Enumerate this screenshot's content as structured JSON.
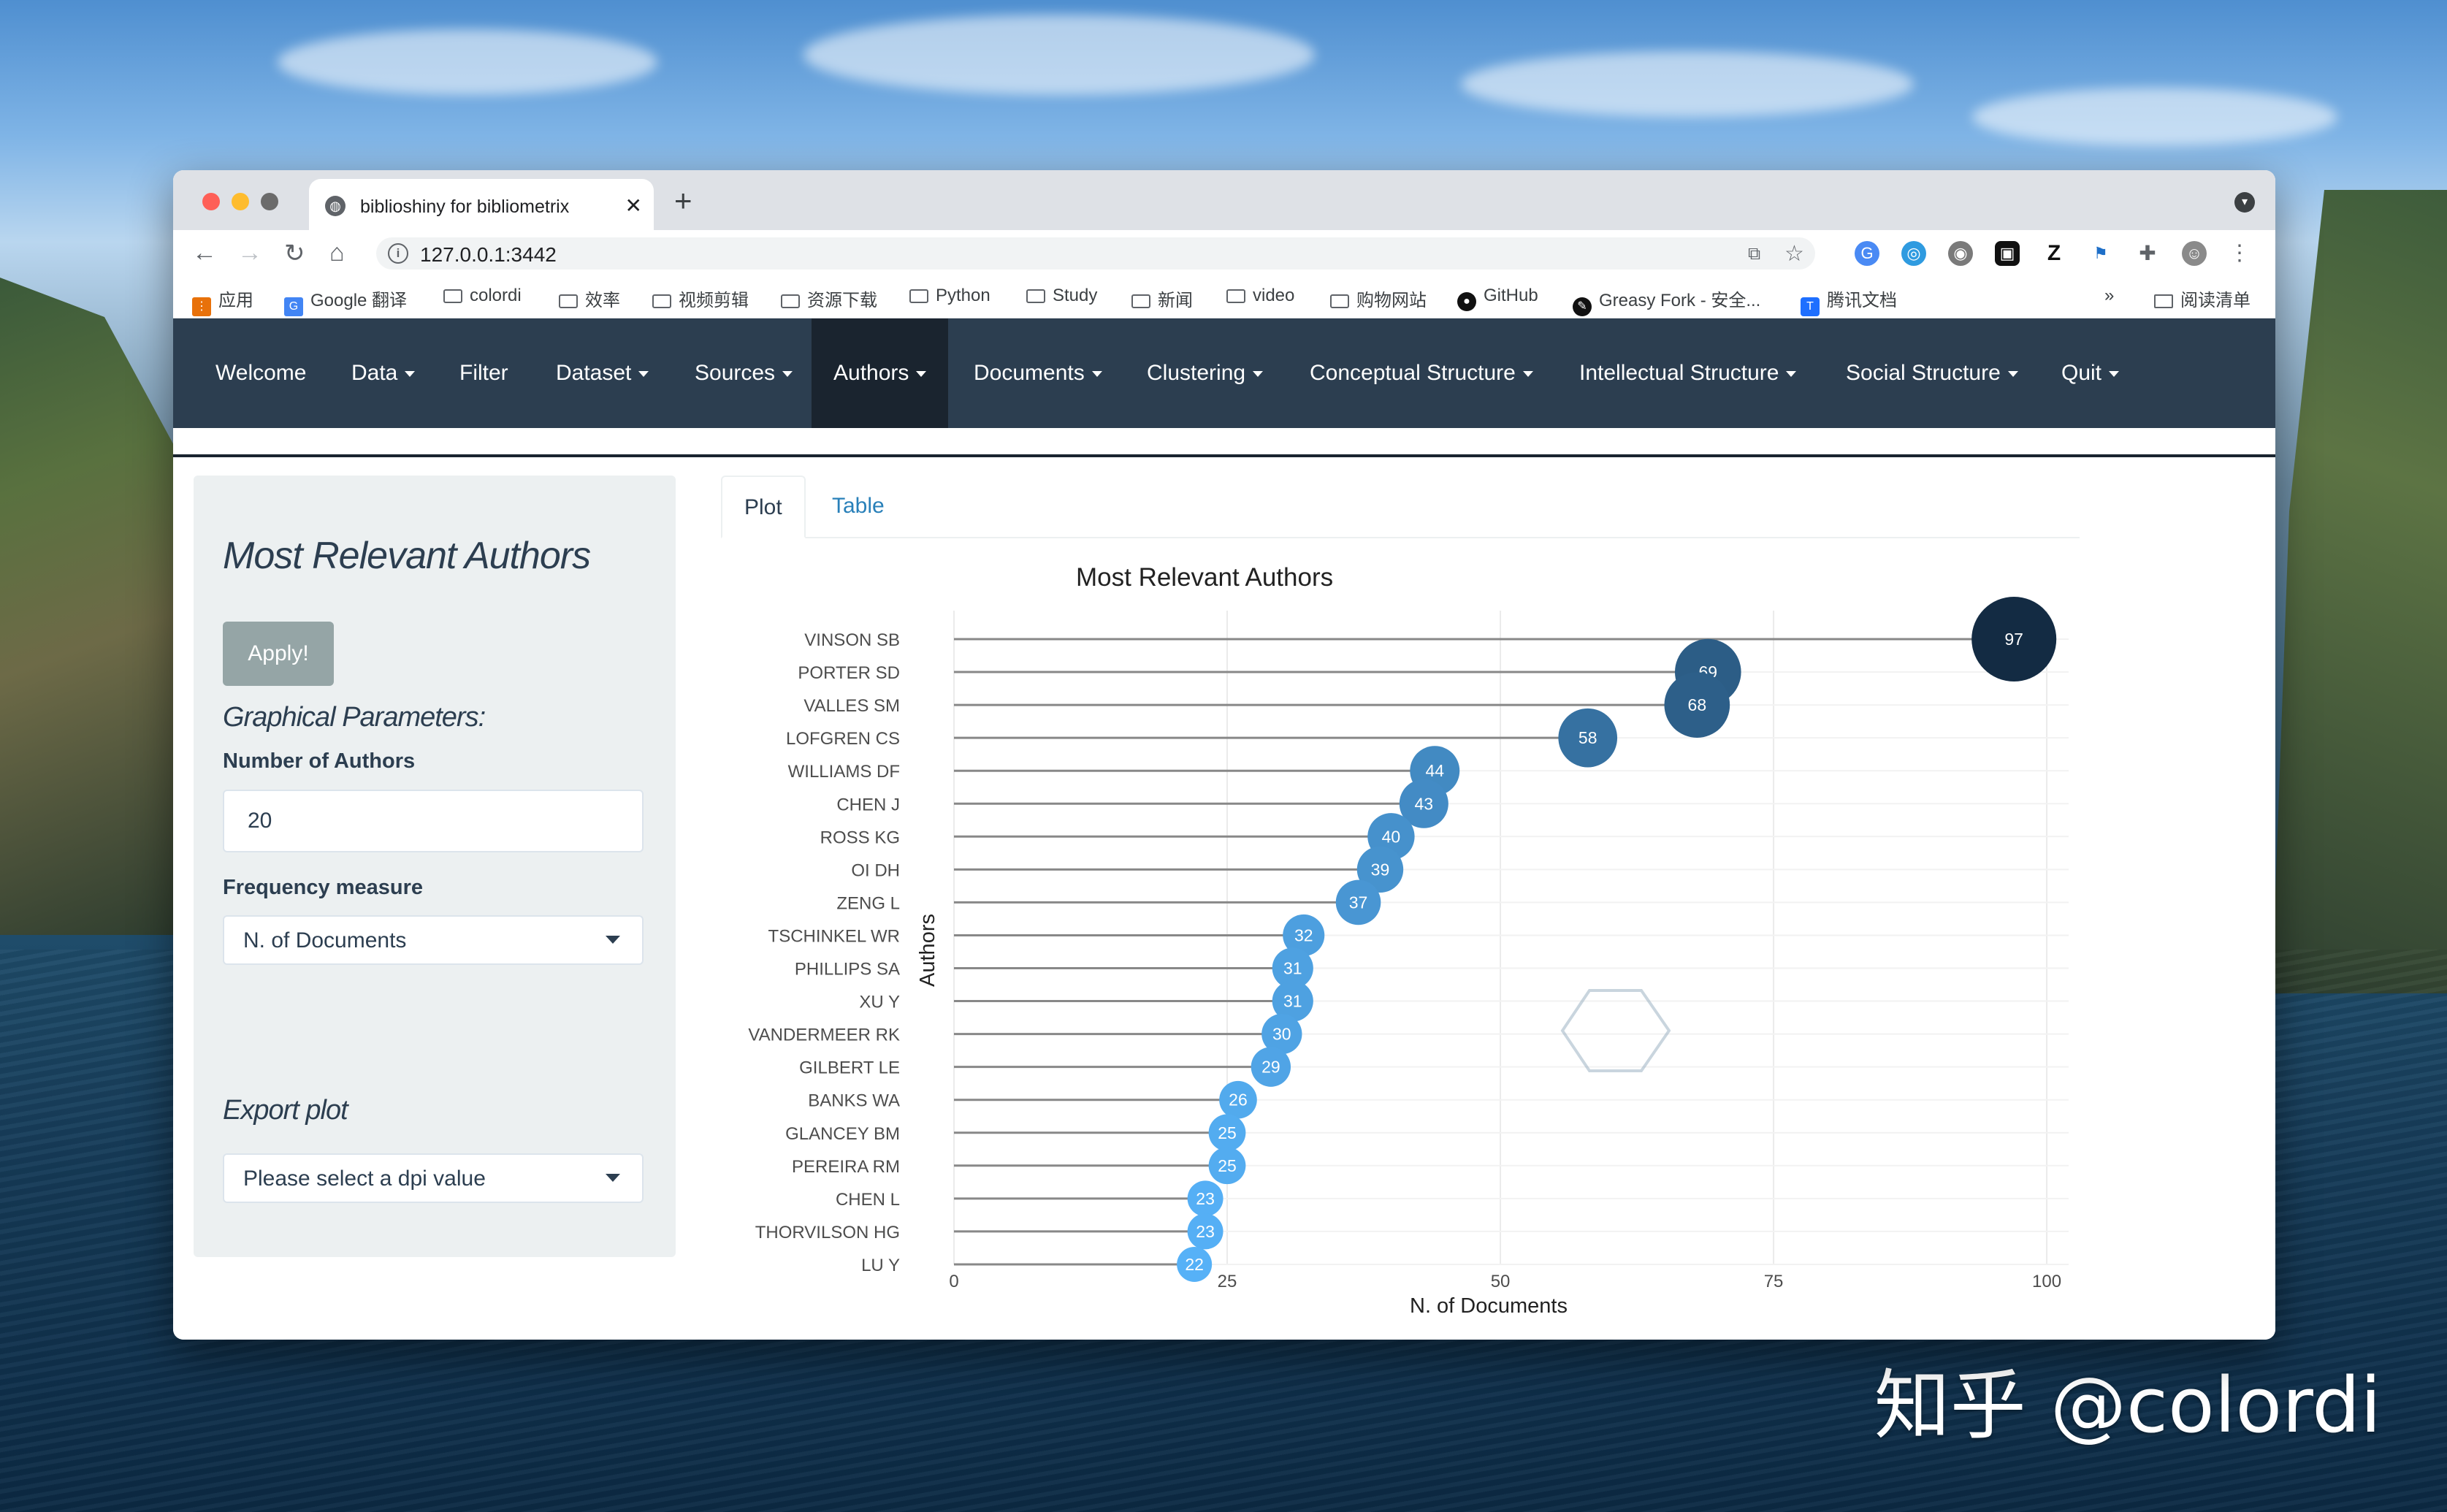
{
  "browser": {
    "tab_title": "biblioshiny for bibliometrix",
    "url": "127.0.0.1:3442",
    "bookmarks": [
      "应用",
      "Google 翻译",
      "colordi",
      "效率",
      "视频剪辑",
      "资源下载",
      "Python",
      "Study",
      "新闻",
      "video",
      "购物网站",
      "GitHub",
      "Greasy Fork - 安全...",
      "腾讯文档"
    ],
    "bookmark_overflow": "»",
    "reading_list": "阅读清单"
  },
  "navbar": {
    "items": [
      {
        "label": "Welcome",
        "dropdown": false
      },
      {
        "label": "Data",
        "dropdown": true
      },
      {
        "label": "Filter",
        "dropdown": false
      },
      {
        "label": "Dataset",
        "dropdown": true
      },
      {
        "label": "Sources",
        "dropdown": true
      },
      {
        "label": "Authors",
        "dropdown": true,
        "active": true
      },
      {
        "label": "Documents",
        "dropdown": true
      },
      {
        "label": "Clustering",
        "dropdown": true
      },
      {
        "label": "Conceptual Structure",
        "dropdown": true
      },
      {
        "label": "Intellectual Structure",
        "dropdown": true
      },
      {
        "label": "Social Structure",
        "dropdown": true
      },
      {
        "label": "Quit",
        "dropdown": true
      }
    ]
  },
  "sidebar": {
    "title": "Most Relevant Authors",
    "apply_label": "Apply!",
    "graphical_parameters": "Graphical Parameters:",
    "num_authors_label": "Number of Authors",
    "num_authors_value": "20",
    "frequency_label": "Frequency measure",
    "frequency_value": "N. of Documents",
    "export_title": "Export plot",
    "dpi_placeholder": "Please select a dpi value"
  },
  "tabs": {
    "plot": "Plot",
    "table": "Table"
  },
  "chart_data": {
    "type": "lollipop",
    "title": "Most Relevant Authors",
    "xlabel": "N. of Documents",
    "ylabel": "Authors",
    "xlim": [
      0,
      102
    ],
    "xticks": [
      0,
      25,
      50,
      75,
      100
    ],
    "grid": true,
    "categories": [
      "VINSON SB",
      "PORTER SD",
      "VALLES SM",
      "LOFGREN CS",
      "WILLIAMS DF",
      "CHEN J",
      "ROSS KG",
      "OI DH",
      "ZENG L",
      "TSCHINKEL WR",
      "PHILLIPS SA",
      "XU Y",
      "VANDERMEER RK",
      "GILBERT LE",
      "BANKS WA",
      "GLANCEY BM",
      "PEREIRA RM",
      "CHEN L",
      "THORVILSON HG",
      "LU Y"
    ],
    "values": [
      97,
      69,
      68,
      58,
      44,
      43,
      40,
      39,
      37,
      32,
      31,
      31,
      30,
      29,
      26,
      25,
      25,
      23,
      23,
      22
    ],
    "color_low": "#56B1F7",
    "color_high": "#132B43"
  },
  "colors": {
    "navbar": "#2c3e50",
    "navbar_active": "#1a242f",
    "link": "#2980b9",
    "sidebar": "#ecf0f1",
    "button": "#95a5a6"
  },
  "watermark": "知乎 @colordi"
}
